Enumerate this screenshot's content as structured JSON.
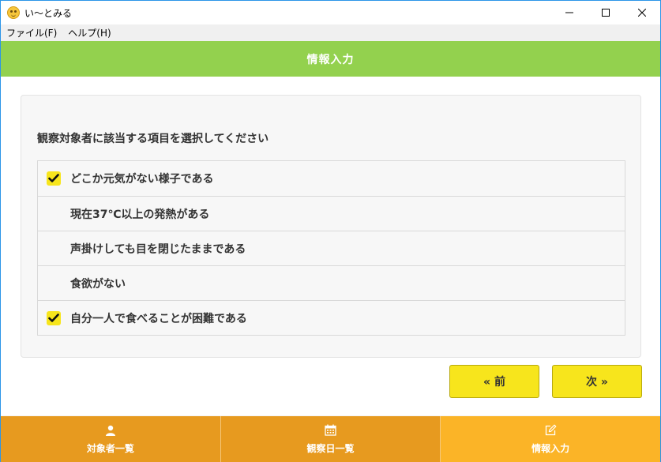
{
  "window": {
    "title": "い〜とみる",
    "app_icon": "smiley-icon"
  },
  "menubar": {
    "items": [
      "ファイル(F)",
      "ヘルプ(H)"
    ]
  },
  "header": {
    "title": "情報入力",
    "color": "#93d14e"
  },
  "main": {
    "prompt": "観察対象者に該当する項目を選択してください",
    "items": [
      {
        "label": "どこか元気がない様子である",
        "checked": true
      },
      {
        "label": "現在37℃以上の発熱がある",
        "checked": false
      },
      {
        "label": "声掛けしても目を閉じたままである",
        "checked": false
      },
      {
        "label": "食欲がない",
        "checked": false
      },
      {
        "label": "自分一人で食べることが困難である",
        "checked": true
      }
    ],
    "prev_label": "« 前",
    "next_label": "次 »"
  },
  "bottom_nav": {
    "tabs": [
      {
        "label": "対象者一覧",
        "icon": "user-icon",
        "active": false
      },
      {
        "label": "観察日一覧",
        "icon": "calendar-icon",
        "active": false
      },
      {
        "label": "情報入力",
        "icon": "edit-icon",
        "active": true
      }
    ]
  },
  "colors": {
    "accent_yellow": "#f7e51c",
    "nav_orange": "#e79a1f",
    "nav_active": "#fbb427"
  }
}
